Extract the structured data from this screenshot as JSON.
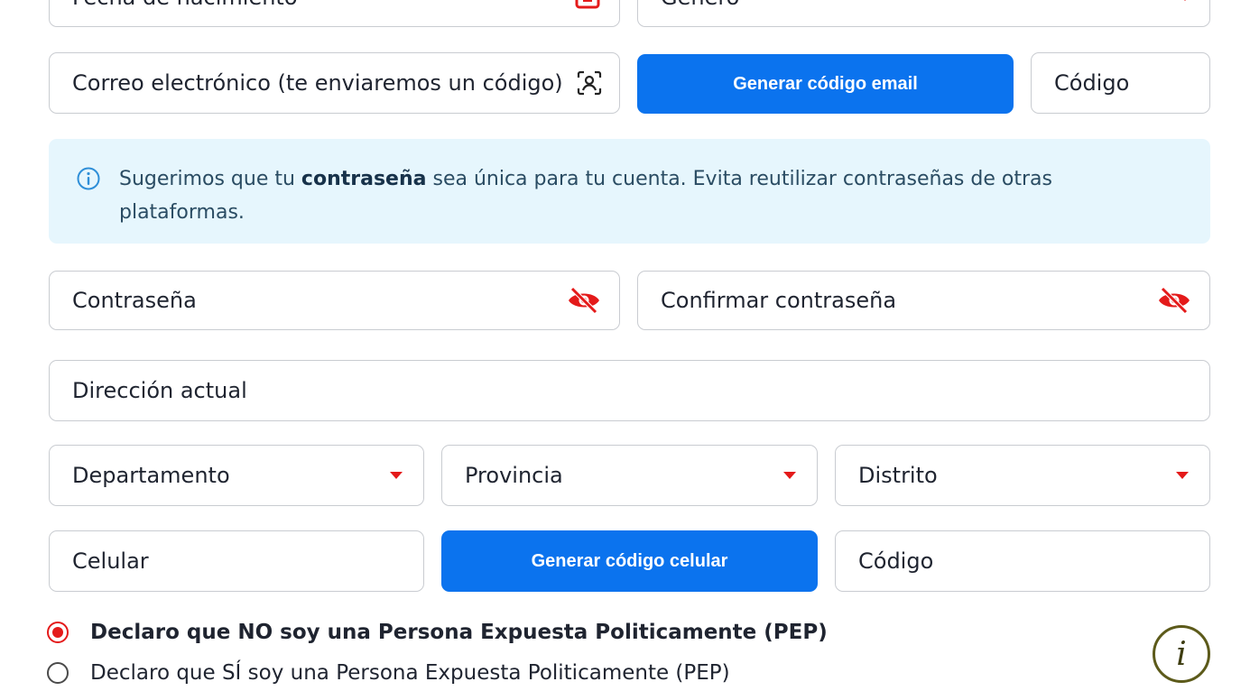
{
  "form": {
    "birth_date": {
      "placeholder": "Fecha de nacimiento",
      "icon": "calendar-icon"
    },
    "gender": {
      "placeholder": "Género"
    },
    "email": {
      "placeholder": "Correo electrónico (te enviaremos un código)",
      "icon": "person-scan-icon"
    },
    "email_code_button": "Generar código email",
    "email_code": {
      "placeholder": "Código"
    },
    "password_notice": {
      "prefix": "Sugerimos que tu ",
      "bold": "contraseña",
      "suffix": " sea única para tu cuenta. Evita reutilizar contraseñas de otras plataformas.",
      "icon": "info-circle-icon"
    },
    "password": {
      "placeholder": "Contraseña",
      "icon": "eye-off-icon"
    },
    "confirm_password": {
      "placeholder": "Confirmar contraseña",
      "icon": "eye-off-icon"
    },
    "address": {
      "placeholder": "Dirección actual"
    },
    "department": {
      "placeholder": "Departamento"
    },
    "province": {
      "placeholder": "Provincia"
    },
    "district": {
      "placeholder": "Distrito"
    },
    "phone": {
      "placeholder": "Celular"
    },
    "phone_code_button": "Generar código celular",
    "phone_code": {
      "placeholder": "Código"
    },
    "pep_options": [
      {
        "label": "Declaro que NO soy una Persona Expuesta Politicamente (PEP)",
        "checked": true
      },
      {
        "label": "Declaro que SÍ soy una Persona Expuesta Politicamente (PEP)",
        "checked": false
      }
    ],
    "help_button": {
      "label": "i",
      "icon": "info-italic-icon"
    }
  },
  "colors": {
    "accent": "#0b73ee",
    "alert": "#e41a1a",
    "notice_bg": "#e6f6fd"
  }
}
